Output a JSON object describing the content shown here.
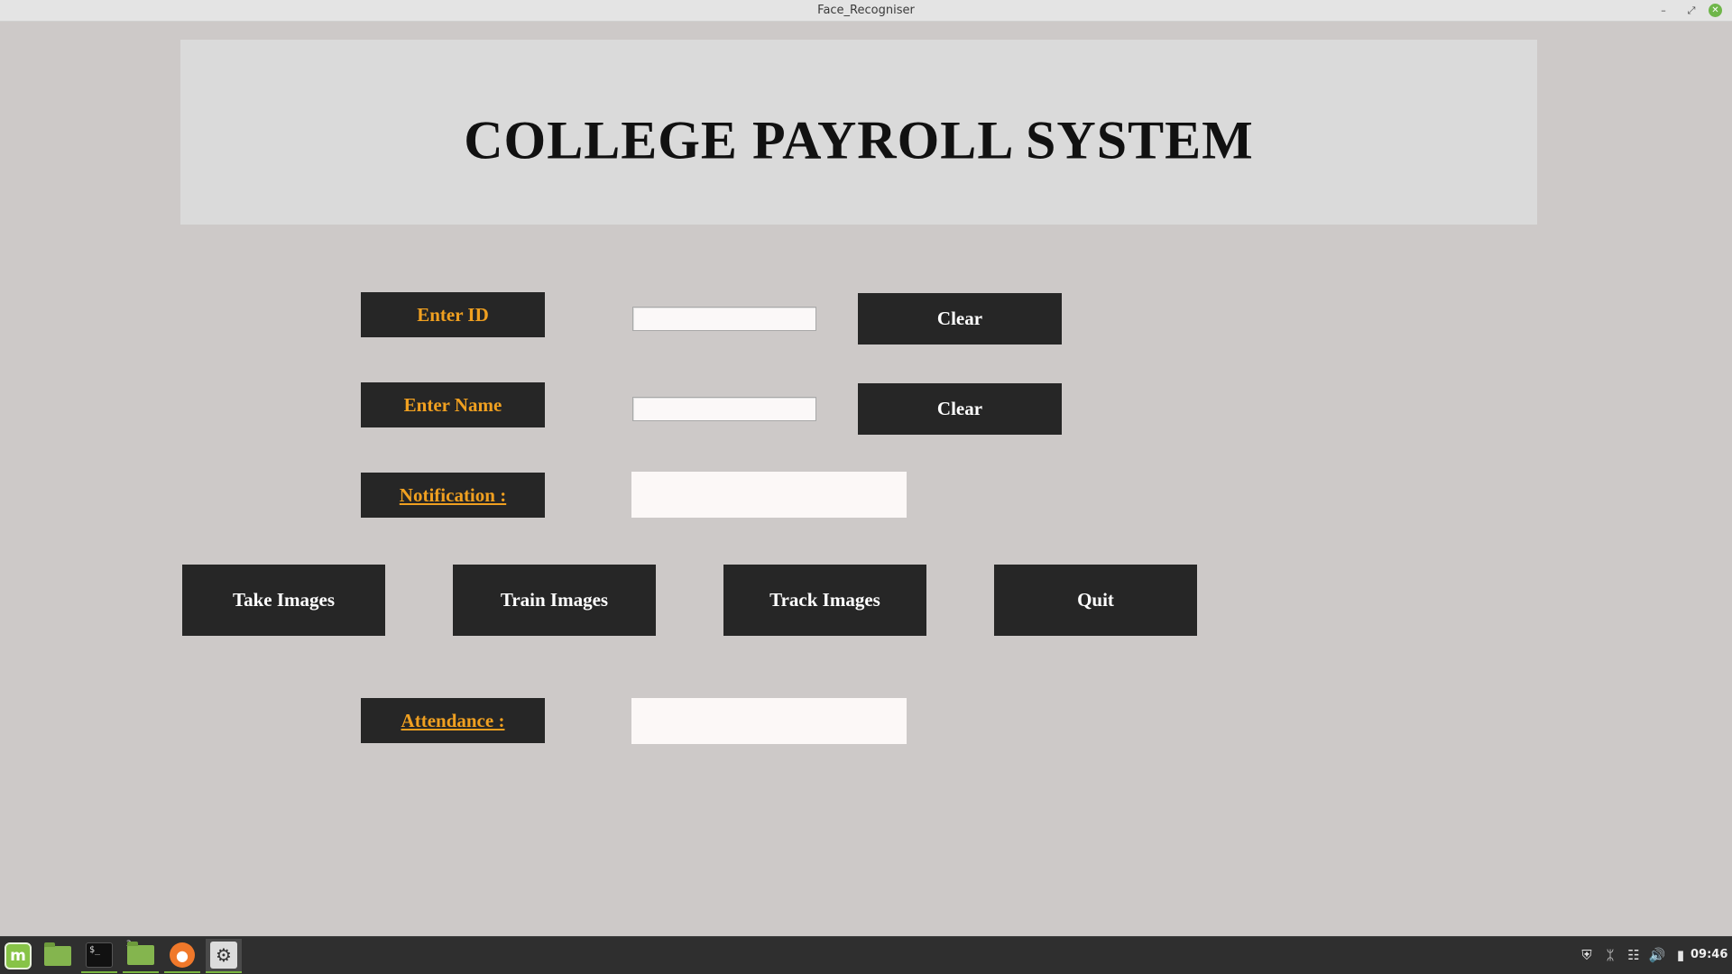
{
  "window": {
    "title": "Face_Recogniser"
  },
  "header": {
    "title": "COLLEGE PAYROLL SYSTEM"
  },
  "form": {
    "id_label": "Enter ID",
    "id_value": "",
    "id_clear": "Clear",
    "name_label": "Enter Name",
    "name_value": "",
    "name_clear": "Clear",
    "notification_label": "Notification : ",
    "notification_text": ""
  },
  "actions": {
    "take": "Take Images",
    "train": "Train Images",
    "track": "Track Images",
    "quit": "Quit"
  },
  "attendance": {
    "label": "Attendance : ",
    "text": ""
  },
  "colors": {
    "label_text": "#f0a020",
    "dark_box": "#262626",
    "background": "#cdc9c8",
    "header_bg": "#dadada"
  },
  "taskbar": {
    "items": [
      "mint-menu-icon",
      "files-icon",
      "terminal-icon",
      "files-icon",
      "firefox-icon",
      "settings-icon"
    ],
    "files_window_count": "2",
    "terminal_prompt": "$_",
    "clock": "09:46"
  }
}
